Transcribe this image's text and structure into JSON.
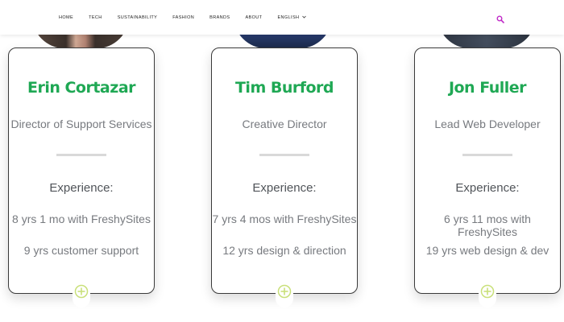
{
  "nav": {
    "items": [
      "HOME",
      "TECH",
      "SUSTAINABILITY",
      "FASHION",
      "BRANDS",
      "ABOUT",
      "ENGLISH"
    ],
    "search_icon": "search-icon",
    "accent_color": "#c02bc8"
  },
  "team": [
    {
      "name": "Erin Cortazar",
      "role": "Director of Support Services",
      "experience_label": "Experience:",
      "experience": [
        "8 yrs 1 mo with FreshySites",
        "9 yrs customer support"
      ]
    },
    {
      "name": "Tim Burford",
      "role": "Creative Director",
      "experience_label": "Experience:",
      "experience": [
        "7 yrs 4 mos with FreshySites",
        "12 yrs design & direction"
      ]
    },
    {
      "name": "Jon Fuller",
      "role": "Lead Web Developer",
      "experience_label": "Experience:",
      "experience": [
        "6 yrs 11 mos with FreshySites",
        "19 yrs web design & dev"
      ]
    }
  ],
  "colors": {
    "name_green": "#1fa854",
    "plus_icon": "#c9e07a",
    "muted_text": "#777a7f"
  },
  "icons": {
    "expand": "plus-circle-icon"
  }
}
